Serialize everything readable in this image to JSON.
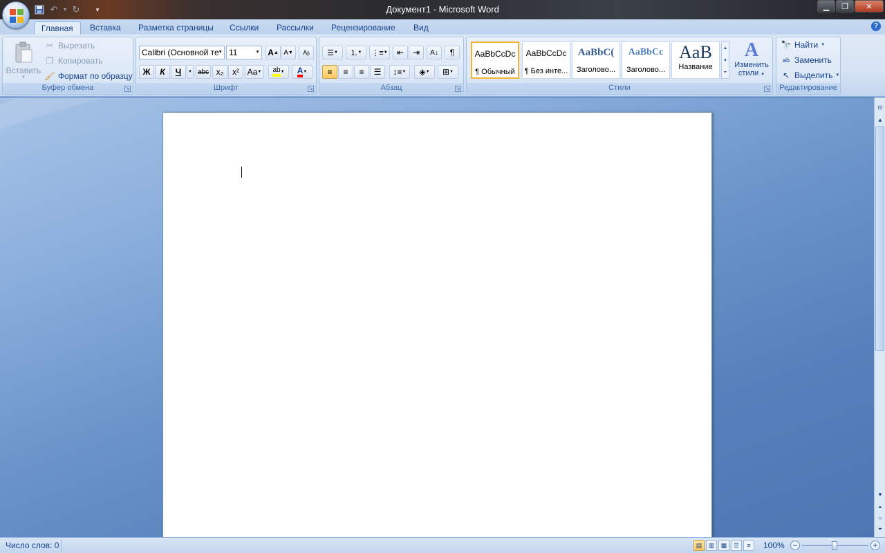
{
  "window": {
    "title": "Документ1 - Microsoft Word"
  },
  "tabs": [
    "Главная",
    "Вставка",
    "Разметка страницы",
    "Ссылки",
    "Рассылки",
    "Рецензирование",
    "Вид"
  ],
  "clipboard": {
    "paste": "Вставить",
    "cut": "Вырезать",
    "copy": "Копировать",
    "format_painter": "Формат по образцу",
    "label": "Буфер обмена"
  },
  "font": {
    "name": "Calibri (Основной те",
    "size": "11",
    "bold": "Ж",
    "italic": "К",
    "underline": "Ч",
    "strike": "abc",
    "sub": "x₂",
    "sup": "x²",
    "case": "Aa",
    "grow": "A",
    "shrink": "A",
    "label": "Шрифт"
  },
  "paragraph": {
    "label": "Абзац"
  },
  "styles": {
    "items": [
      {
        "sample": "AaBbCcDc",
        "name": "¶ Обычный"
      },
      {
        "sample": "AaBbCcDc",
        "name": "¶ Без инте..."
      },
      {
        "sample": "AaBbC(",
        "name": "Заголово..."
      },
      {
        "sample": "AaBbCc",
        "name": "Заголово..."
      },
      {
        "sample": "AaB",
        "name": "Название"
      }
    ],
    "change": "Изменить стили",
    "change_line1": "Изменить",
    "change_line2": "стили",
    "label": "Стили"
  },
  "editing": {
    "find": "Найти",
    "replace": "Заменить",
    "select": "Выделить",
    "label": "Редактирование"
  },
  "status": {
    "word_count": "Число слов: 0",
    "zoom": "100%"
  },
  "colors": {
    "accent": "#15428b",
    "highlight": "#ffff00",
    "font_color": "#ff0000"
  }
}
